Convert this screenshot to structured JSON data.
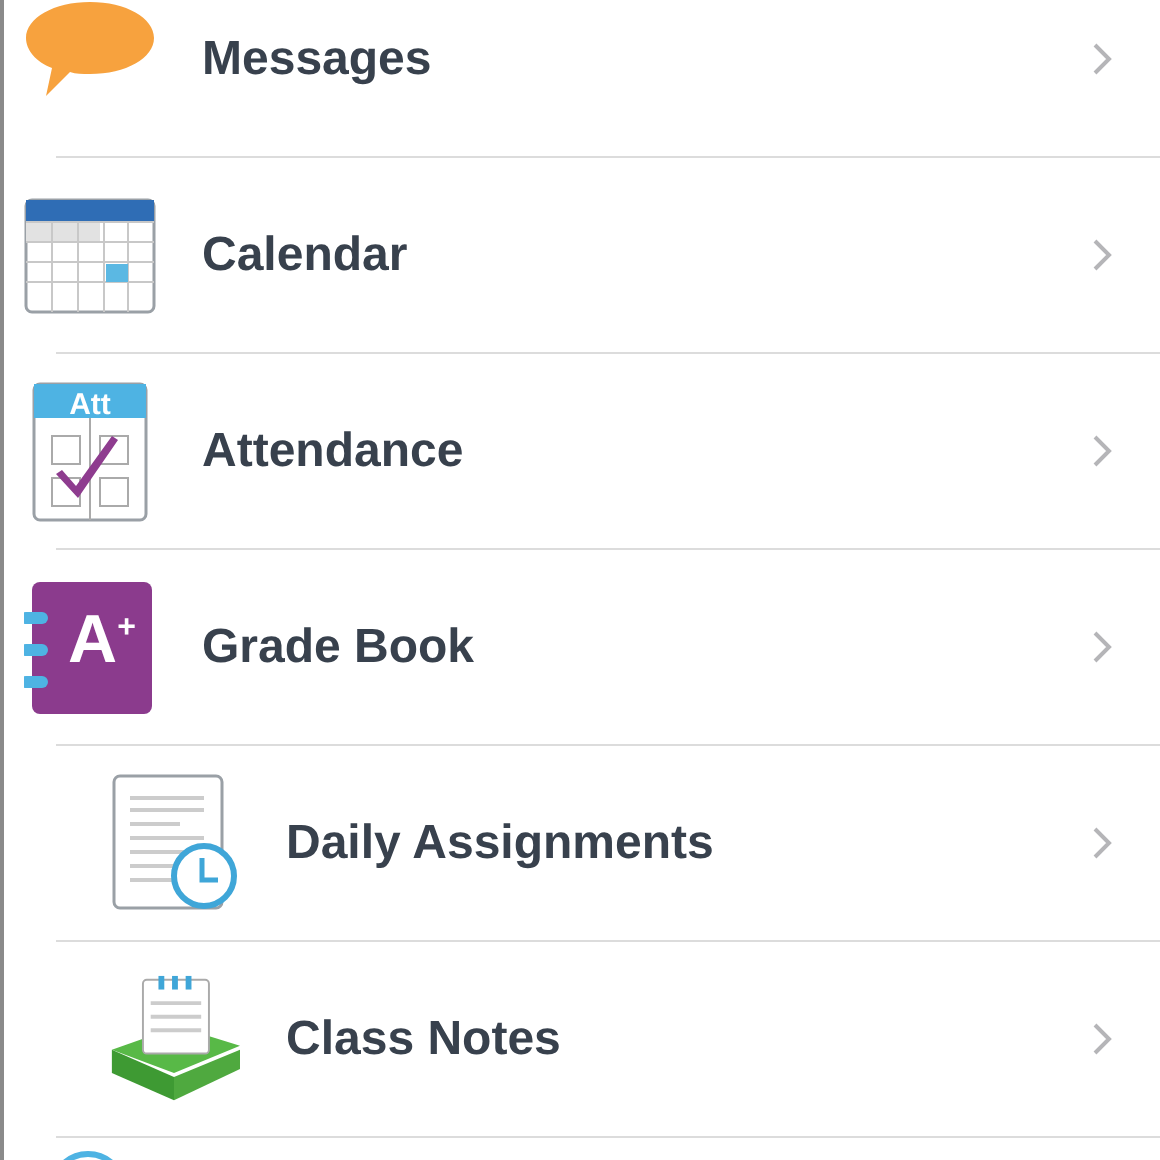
{
  "menu": [
    {
      "label": "Messages",
      "kind": "speech-bubble"
    },
    {
      "label": "Calendar",
      "kind": "calendar"
    },
    {
      "label": "Attendance",
      "kind": "attendance",
      "icon_text": "Att"
    },
    {
      "label": "Grade Book",
      "kind": "gradebook",
      "icon_text": "A$^{+}$",
      "children": [
        {
          "label": "Daily Assignments",
          "kind": "document-clock"
        },
        {
          "label": "Class Notes",
          "kind": "notes-book"
        }
      ]
    },
    {
      "kind": "circle"
    }
  ]
}
